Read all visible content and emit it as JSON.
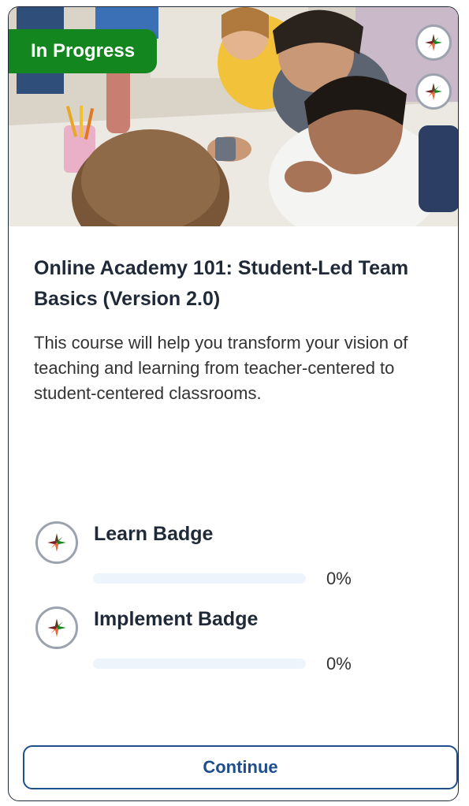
{
  "course": {
    "status": "In Progress",
    "title": "Online Academy 101: Student-Led Team Basics (Version 2.0)",
    "description": "This course will help you transform your vision of teaching and learning from teacher-centered to student-centered classrooms.",
    "hero_image": "students-collaborating-photo",
    "status_color": "#14861f"
  },
  "badges": [
    {
      "name": "Learn Badge",
      "progress_percent": 0,
      "progress_label": "0%",
      "icon": "badge-emblem-icon"
    },
    {
      "name": "Implement Badge",
      "progress_percent": 0,
      "progress_label": "0%",
      "icon": "badge-emblem-icon"
    }
  ],
  "actions": {
    "continue_label": "Continue"
  },
  "colors": {
    "accent": "#1e4e8c",
    "progress_track": "#eef4fb",
    "badge_ring": "#9ca3af"
  }
}
